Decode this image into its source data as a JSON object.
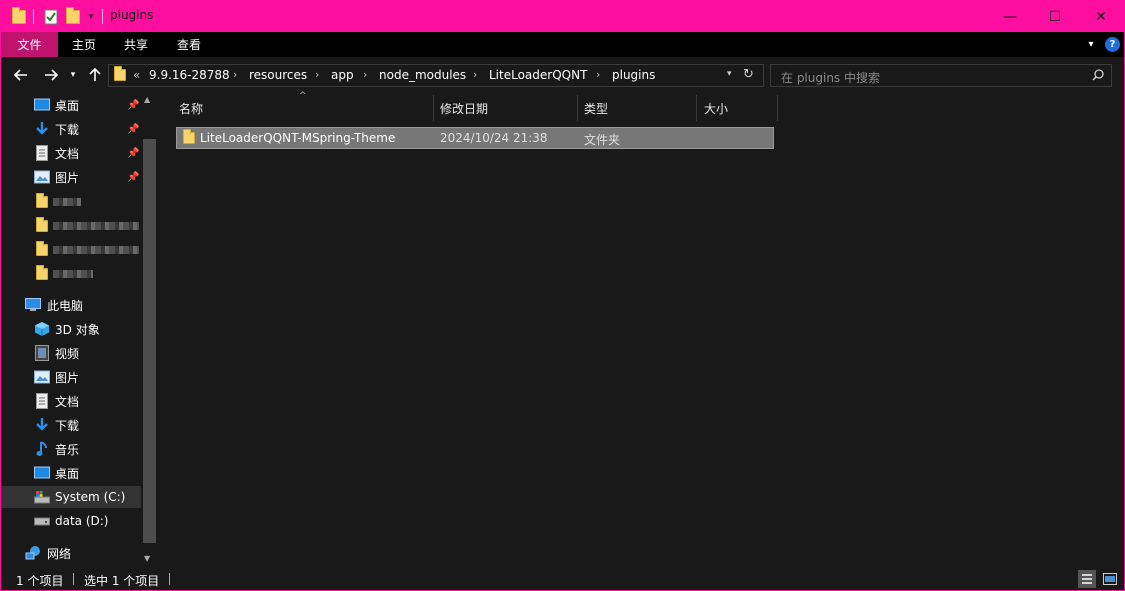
{
  "window": {
    "title": "plugins",
    "minimize_glyph": "—",
    "maximize_glyph": "☐",
    "close_glyph": "✕"
  },
  "ribbon": {
    "tabs": [
      {
        "label": "文件"
      },
      {
        "label": "主页"
      },
      {
        "label": "共享"
      },
      {
        "label": "查看"
      }
    ],
    "help_glyph": "?"
  },
  "address": {
    "overflow": "«",
    "crumbs": [
      "9.9.16-28788",
      "resources",
      "app",
      "node_modules",
      "LiteLoaderQQNT",
      "plugins"
    ],
    "separator": "›"
  },
  "search": {
    "placeholder": "在 plugins 中搜索"
  },
  "nav": {
    "quick_access": [
      {
        "label": "桌面",
        "icon": "desktop-icon"
      },
      {
        "label": "下载",
        "icon": "download-icon"
      },
      {
        "label": "文档",
        "icon": "document-icon"
      },
      {
        "label": "图片",
        "icon": "picture-icon"
      }
    ],
    "this_pc_label": "此电脑",
    "this_pc_items": [
      {
        "label": "3D 对象",
        "icon": "3d-objects-icon"
      },
      {
        "label": "视频",
        "icon": "video-icon"
      },
      {
        "label": "图片",
        "icon": "picture-icon"
      },
      {
        "label": "文档",
        "icon": "document-icon"
      },
      {
        "label": "下载",
        "icon": "download-icon"
      },
      {
        "label": "音乐",
        "icon": "music-icon"
      },
      {
        "label": "桌面",
        "icon": "desktop-icon"
      },
      {
        "label": "System (C:)",
        "icon": "system-drive-icon"
      },
      {
        "label": "data (D:)",
        "icon": "drive-icon"
      }
    ],
    "network_label": "网络"
  },
  "columns": [
    "名称",
    "修改日期",
    "类型",
    "大小"
  ],
  "files": [
    {
      "name": "LiteLoaderQQNT-MSpring-Theme",
      "modified": "2024/10/24 21:38",
      "type": "文件夹",
      "size": ""
    }
  ],
  "status": {
    "item_count": "1 个项目",
    "selected": "选中 1 个项目"
  },
  "colors": {
    "accent": "#ff0fa0",
    "file_tab": "#c0136e",
    "background": "#191919",
    "selection": "#777777"
  }
}
